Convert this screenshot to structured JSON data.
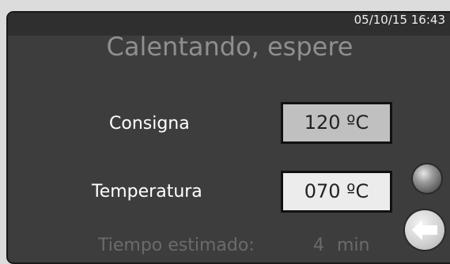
{
  "header": {
    "datetime": "05/10/15 16:43"
  },
  "title": "Calentando, espere",
  "setpoint": {
    "label": "Consigna",
    "value": "120 ºC",
    "box_color": "#c0c0c0"
  },
  "temperature": {
    "label": "Temperatura",
    "value": "070 ºC",
    "box_color": "#ececec"
  },
  "estimate": {
    "label": "Tiempo estimado:",
    "value": "4",
    "unit": "min"
  },
  "controls": {
    "status_led": "status-led-icon",
    "back": "back-arrow-icon"
  },
  "colors": {
    "panel": "#3d3d3d",
    "title": "#8f8f8f",
    "label": "#ffffff",
    "dim_text": "#6b6b6b"
  }
}
